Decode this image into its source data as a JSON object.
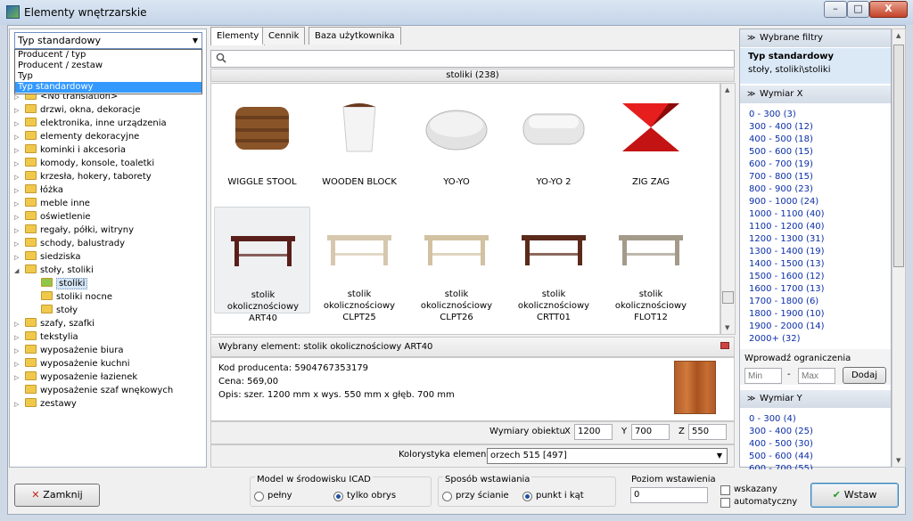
{
  "window": {
    "title": "Elementy wnętrzarskie",
    "min": "–",
    "max": "□",
    "close": "X"
  },
  "left": {
    "select_value": "Typ standardowy",
    "dropdown_options": [
      "Producent / typ",
      "Producent / zestaw",
      "Typ",
      "Typ standardowy"
    ],
    "tree": [
      "<No translation>",
      "drzwi, okna, dekoracje",
      "elektronika, inne urządzenia",
      "elementy dekoracyjne",
      "kominki i akcesoria",
      "komody, konsole, toaletki",
      "krzesła, hokery, taborety",
      "łóżka",
      "meble inne",
      "oświetlenie",
      "regały, półki, witryny",
      "schody, balustrady",
      "siedziska",
      "stoły, stoliki",
      "stoliki",
      "stoliki nocne",
      "stoły",
      "szafy, szafki",
      "tekstylia",
      "wyposażenie biura",
      "wyposażenie kuchni",
      "wyposażenie łazienek",
      "wyposażenie szaf wnękowych",
      "zestawy"
    ]
  },
  "tabs": [
    "Elementy",
    "Cennik",
    "Baza użytkownika"
  ],
  "category_header": "stoliki (238)",
  "items": [
    {
      "name": "WIGGLE STOOL",
      "icon": "wiggle-stool-icon"
    },
    {
      "name": "WOODEN BLOCK",
      "icon": "wooden-block-icon"
    },
    {
      "name": "YO-YO",
      "icon": "yoyo-icon"
    },
    {
      "name": "YO-YO 2",
      "icon": "yoyo2-icon"
    },
    {
      "name": "ZIG ZAG",
      "icon": "zigzag-icon"
    },
    {
      "name": "stolik okolicznościowy ART40",
      "icon": "table-icon"
    },
    {
      "name": "stolik okolicznościowy CLPT25",
      "icon": "table-icon"
    },
    {
      "name": "stolik okolicznościowy CLPT26",
      "icon": "table-icon"
    },
    {
      "name": "stolik okolicznościowy CRTT01",
      "icon": "table-icon"
    },
    {
      "name": "stolik okolicznościowy FLOT12",
      "icon": "table-icon"
    }
  ],
  "details": {
    "selected": "Wybrany element: stolik okolicznościowy ART40",
    "code": "Kod producenta: 5904767353179",
    "price": "Cena: 569,00",
    "desc": "Opis: szer. 1200 mm x wys. 550 mm x głęb. 700  mm",
    "dims_label": "Wymiary obiektu",
    "x_label": "X",
    "x": "1200",
    "y_label": "Y",
    "y": "700",
    "z_label": "Z",
    "z": "550",
    "color_label": "Kolorystyka elementu",
    "color_value": "orzech 515 [497]"
  },
  "right": {
    "selected_filters_head": "Wybrane filtry",
    "filter_title": "Typ standardowy",
    "filter_path": "stoły, stoliki\\stoliki",
    "dim_x_head": "Wymiar X",
    "dim_x": [
      "0 - 300  (3)",
      "300 - 400  (12)",
      "400 - 500  (18)",
      "500 - 600  (15)",
      "600 - 700  (19)",
      "700 - 800  (15)",
      "800 - 900  (23)",
      "900 - 1000  (24)",
      "1000 - 1100  (40)",
      "1100 - 1200  (40)",
      "1200 - 1300  (31)",
      "1300 - 1400  (19)",
      "1400 - 1500  (13)",
      "1500 - 1600  (12)",
      "1600 - 1700  (13)",
      "1700 - 1800  (6)",
      "1800 - 1900  (10)",
      "1900 - 2000  (14)",
      "2000+  (32)"
    ],
    "limits_label": "Wprowadź ograniczenia",
    "min_ph": "Min",
    "dash": "-",
    "max_ph": "Max",
    "add": "Dodaj",
    "dim_y_head": "Wymiar Y",
    "dim_y": [
      "0 - 300  (4)",
      "300 - 400  (25)",
      "400 - 500  (30)",
      "500 - 600  (44)",
      "600 - 700  (55)"
    ]
  },
  "bottom": {
    "close": "Zamknij",
    "model_group": "Model w środowisku ICAD",
    "full": "pełny",
    "outline": "tylko obrys",
    "insert_group": "Sposób wstawiania",
    "wall": "przy ścianie",
    "point": "punkt i kąt",
    "level_label": "Poziom wstawienia",
    "level": "0",
    "pointed": "wskazany",
    "auto": "automatyczny",
    "insert": "Wstaw"
  }
}
